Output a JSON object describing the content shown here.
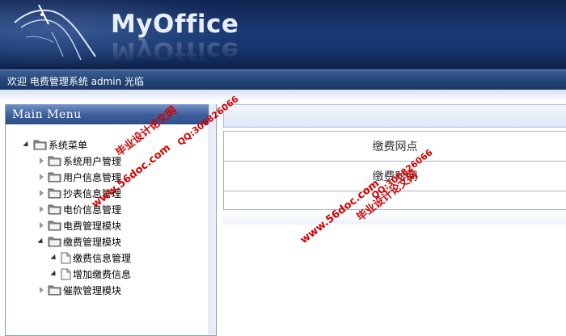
{
  "app": {
    "logo_text": "MyOffice",
    "welcome": "欢迎 电费管理系统 admin 光临"
  },
  "menu": {
    "title": "Main Menu",
    "root": {
      "label": "系统菜单",
      "expanded": true
    },
    "items": [
      {
        "label": "系统用户管理",
        "expanded": false
      },
      {
        "label": "用户信息管理",
        "expanded": false
      },
      {
        "label": "抄表信息管理",
        "expanded": false
      },
      {
        "label": "电价信息管理",
        "expanded": false
      },
      {
        "label": "电费管理模块",
        "expanded": false
      },
      {
        "label": "缴费管理模块",
        "expanded": true,
        "children": [
          {
            "label": "缴费信息管理"
          },
          {
            "label": "增加缴费信息"
          }
        ]
      },
      {
        "label": "催款管理模块",
        "expanded": false
      }
    ]
  },
  "content": {
    "fields": [
      {
        "label": "缴费网点"
      },
      {
        "label": "缴费时间"
      }
    ]
  },
  "watermarks": [
    {
      "text": "毕业设计论文网"
    },
    {
      "text": "QQ:306826066"
    },
    {
      "text": "www.56doc.com"
    }
  ],
  "colors": {
    "banner": "#16356d",
    "welcome_bar": "#234375",
    "menu_header": "#3e5f9b",
    "watermark": "#d40000"
  }
}
